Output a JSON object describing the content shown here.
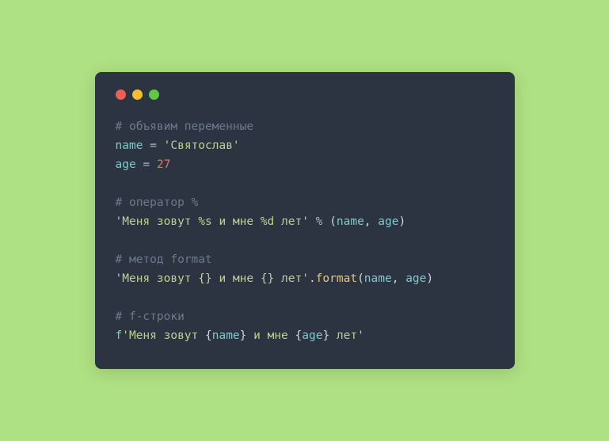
{
  "code": {
    "c1": "# объявим переменные",
    "l2_name": "name",
    "l2_eq": " = ",
    "l2_str": "'Святослав'",
    "l3_name": "age",
    "l3_eq": " = ",
    "l3_num": "27",
    "c2": "# оператор %",
    "l5_str": "'Меня зовут %s и мне %d лет'",
    "l5_op": " % ",
    "l5_p1": "(",
    "l5_a1": "name",
    "l5_comma": ", ",
    "l5_a2": "age",
    "l5_p2": ")",
    "c3": "# метод format",
    "l7_str": "'Меня зовут {} и мне {} лет'",
    "l7_dot": ".",
    "l7_fn": "format",
    "l7_p1": "(",
    "l7_a1": "name",
    "l7_comma": ", ",
    "l7_a2": "age",
    "l7_p2": ")",
    "c4": "# f-строки",
    "l9_f": "f",
    "l9_s1": "'Меня зовут ",
    "l9_b1": "{",
    "l9_v1": "name",
    "l9_b2": "}",
    "l9_s2": " и мне ",
    "l9_b3": "{",
    "l9_v2": "age",
    "l9_b4": "}",
    "l9_s3": " лет'"
  }
}
